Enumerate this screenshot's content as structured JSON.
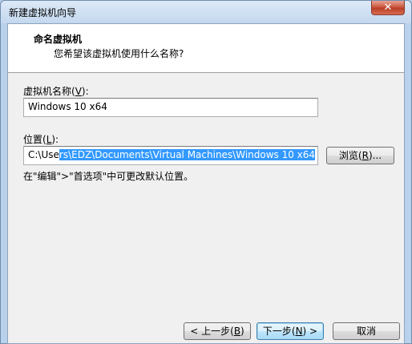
{
  "window": {
    "title": "新建虚拟机向导",
    "close_glyph": "✕"
  },
  "header": {
    "title": "命名虚拟机",
    "subtitle": "您希望该虚拟机使用什么名称?"
  },
  "name_field": {
    "label_prefix": "虚拟机名称(",
    "label_key": "V",
    "label_suffix": "):",
    "value": "Windows 10 x64"
  },
  "location_field": {
    "label_prefix": "位置(",
    "label_key": "L",
    "label_suffix": "):",
    "value_unselected": "C:\\Use",
    "value_selected": "rs\\EDZ\\Documents\\Virtual Machines\\Windows 10 x64"
  },
  "browse_button": {
    "prefix": "浏览(",
    "key": "R",
    "suffix": ")..."
  },
  "hint": "在\"编辑\">\"首选项\"中可更改默认位置。",
  "buttons": {
    "back": {
      "prefix": "< 上一步(",
      "key": "B",
      "suffix": ")"
    },
    "next": {
      "prefix": "下一步(",
      "key": "N",
      "suffix": ") >"
    },
    "cancel": "取消"
  }
}
